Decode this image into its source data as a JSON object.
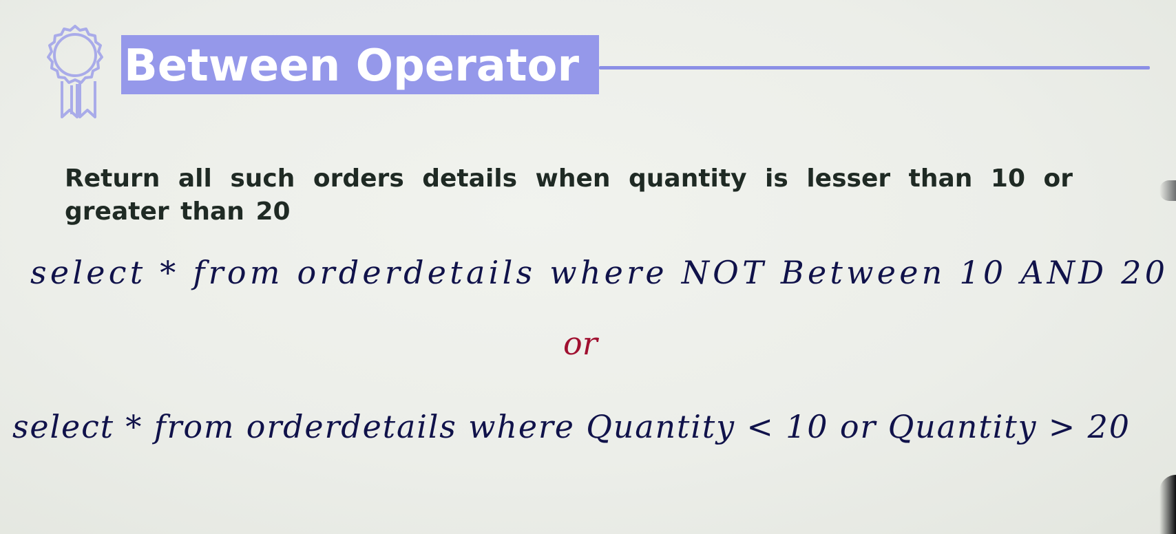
{
  "slide": {
    "title": "Between Operator",
    "badge_icon": "award-ribbon-icon",
    "question": "Return all such orders details when quantity is lesser than 10 or greater than 20"
  },
  "handwriting": {
    "line1": "select * from orderdetails where NOT Between 10 AND 20",
    "separator": "or",
    "line2": "select * from orderdetails where Quantity < 10 or Quantity > 20"
  },
  "colors": {
    "title_bg": "#9598ea",
    "title_rule": "#8b8fe6",
    "ink": "#10124a",
    "separator_ink": "#a01030",
    "question_text": "#1f2a24"
  }
}
